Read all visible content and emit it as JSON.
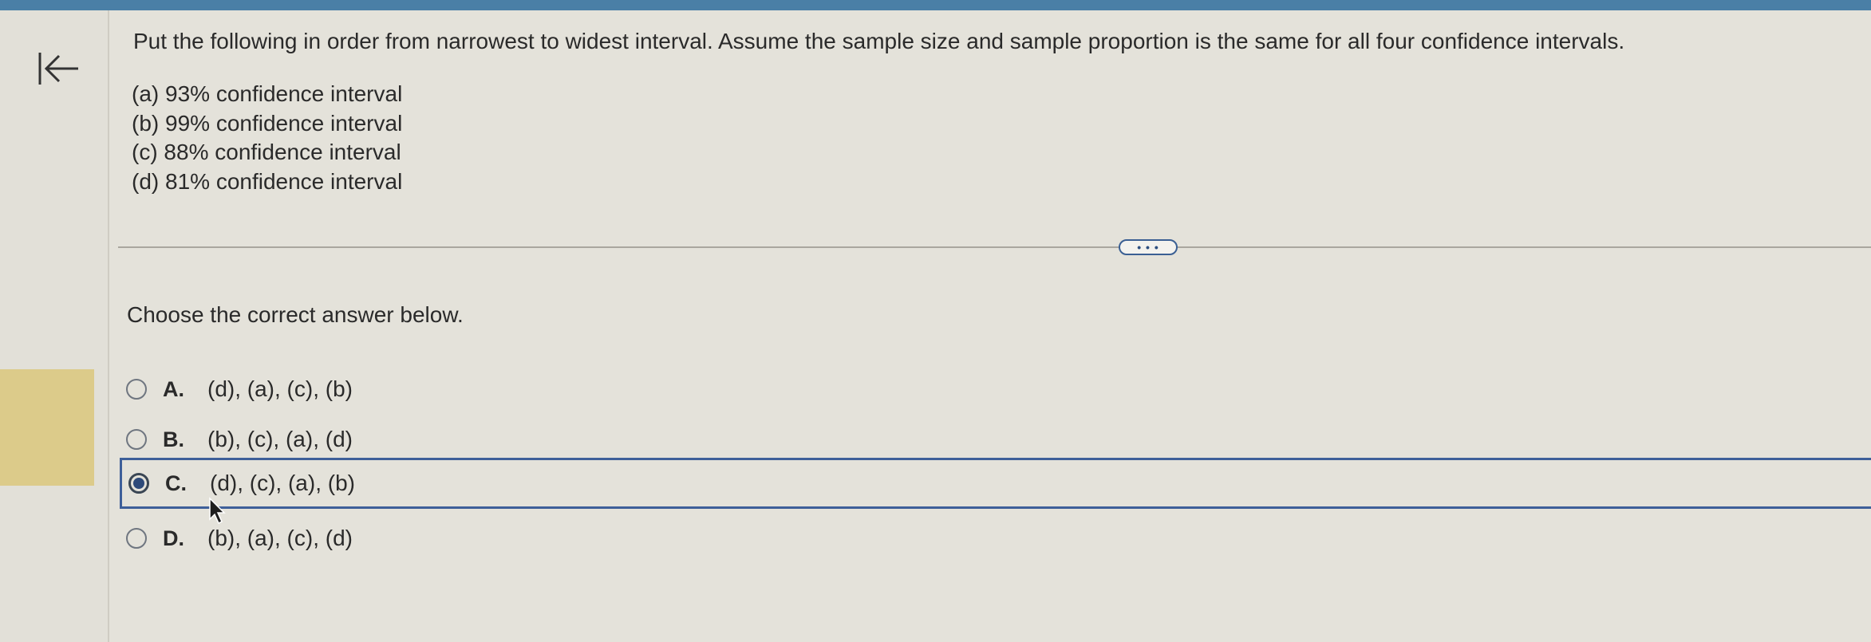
{
  "question": {
    "text": "Put the following in order from narrowest to widest interval. Assume the sample size and sample proportion is the same for all four confidence intervals.",
    "items": [
      "(a) 93% confidence interval",
      "(b) 99% confidence interval",
      "(c) 88% confidence interval",
      "(d) 81% confidence interval"
    ]
  },
  "more_button": {
    "label": "• • •"
  },
  "prompt": "Choose the correct answer below.",
  "options": [
    {
      "letter": "A.",
      "text": "(d), (a), (c), (b)",
      "selected": false
    },
    {
      "letter": "B.",
      "text": "(b), (c), (a), (d)",
      "selected": false
    },
    {
      "letter": "C.",
      "text": "(d), (c), (a), (b)",
      "selected": true
    },
    {
      "letter": "D.",
      "text": "(b), (a), (c), (d)",
      "selected": false
    }
  ],
  "icons": {
    "back": "collapse-left-icon",
    "cursor": "mouse-pointer-icon"
  },
  "colors": {
    "accent": "#3e5f99",
    "topbar": "#4a7fa6",
    "background": "#e4e2da"
  }
}
